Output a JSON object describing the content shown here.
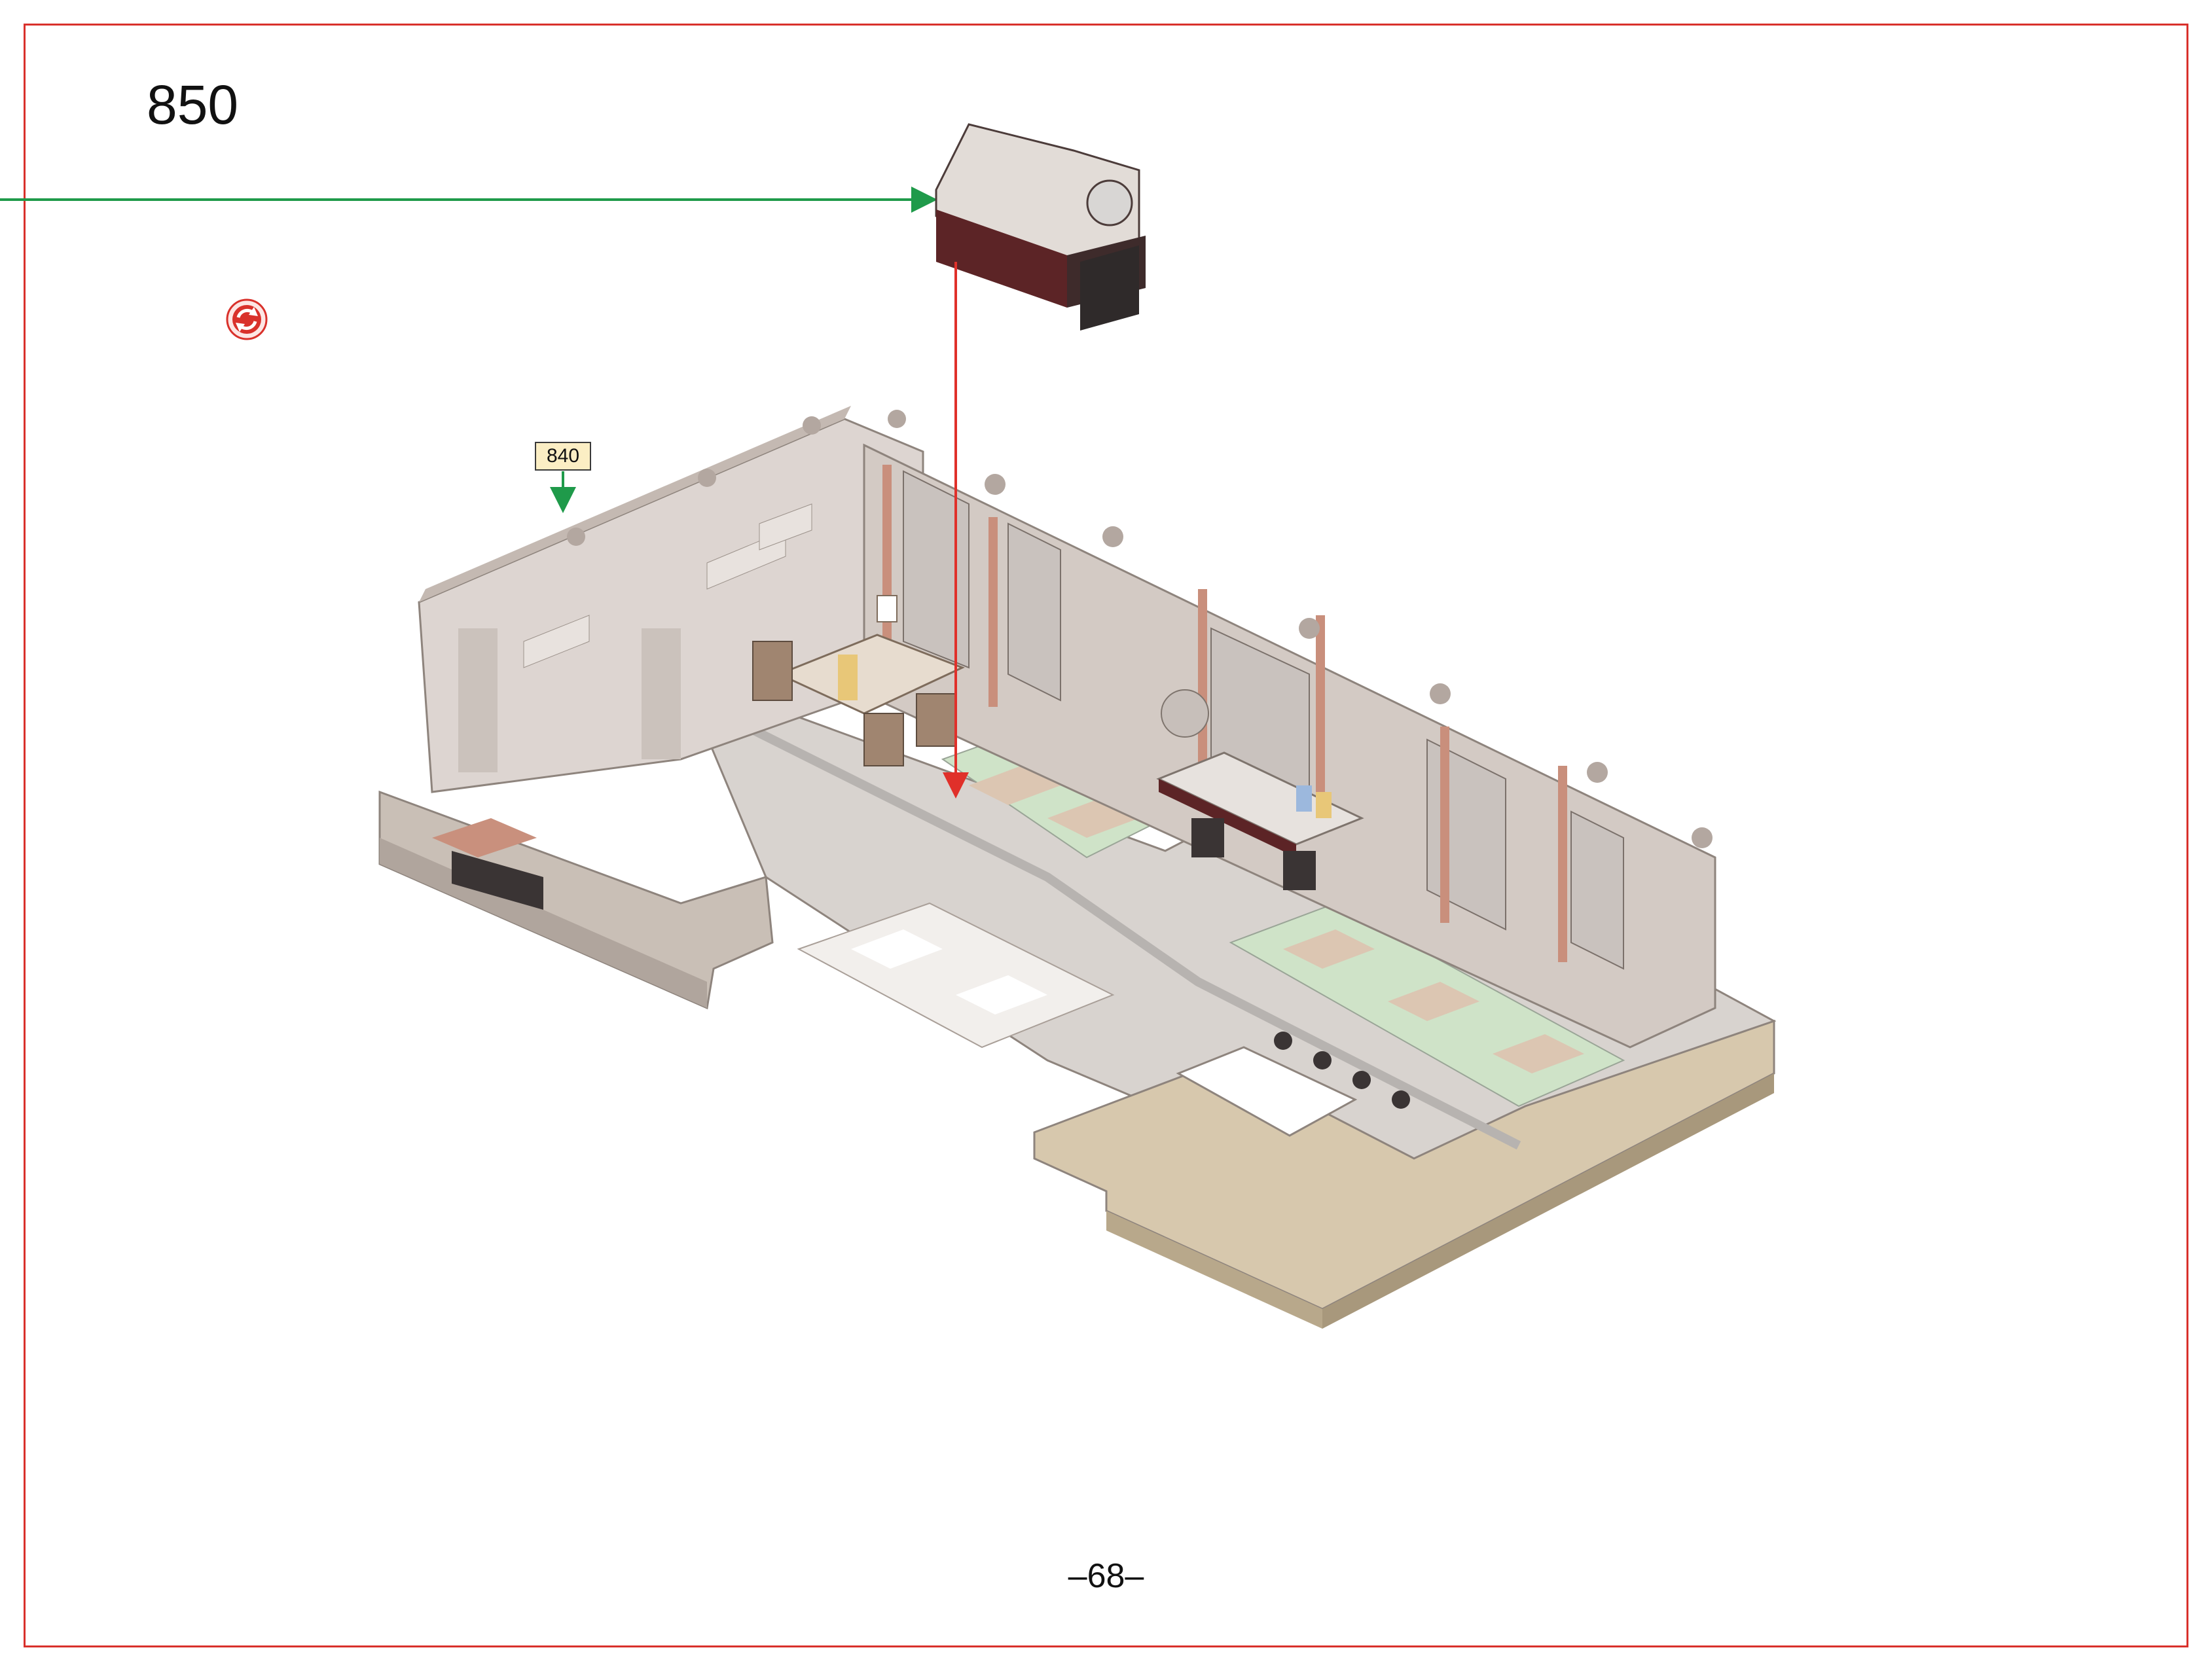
{
  "page": {
    "step_number": "850",
    "page_number": "–68–",
    "callout_label": "840"
  },
  "colors": {
    "frame_border": "#d9312b",
    "callout_bg": "#fbeec4",
    "arrow_green": "#1f9a4a",
    "arrow_red": "#e0302a",
    "brick_light": "#d9d2cd",
    "brick_mid": "#b9aea7",
    "baseplate_tan": "#d7c8ad",
    "tile_green": "#cfe3c8",
    "tile_tan": "#dcc6b2",
    "counter_darkred": "#5c2426"
  },
  "icons": {
    "rotate": "rotate-model-icon"
  }
}
